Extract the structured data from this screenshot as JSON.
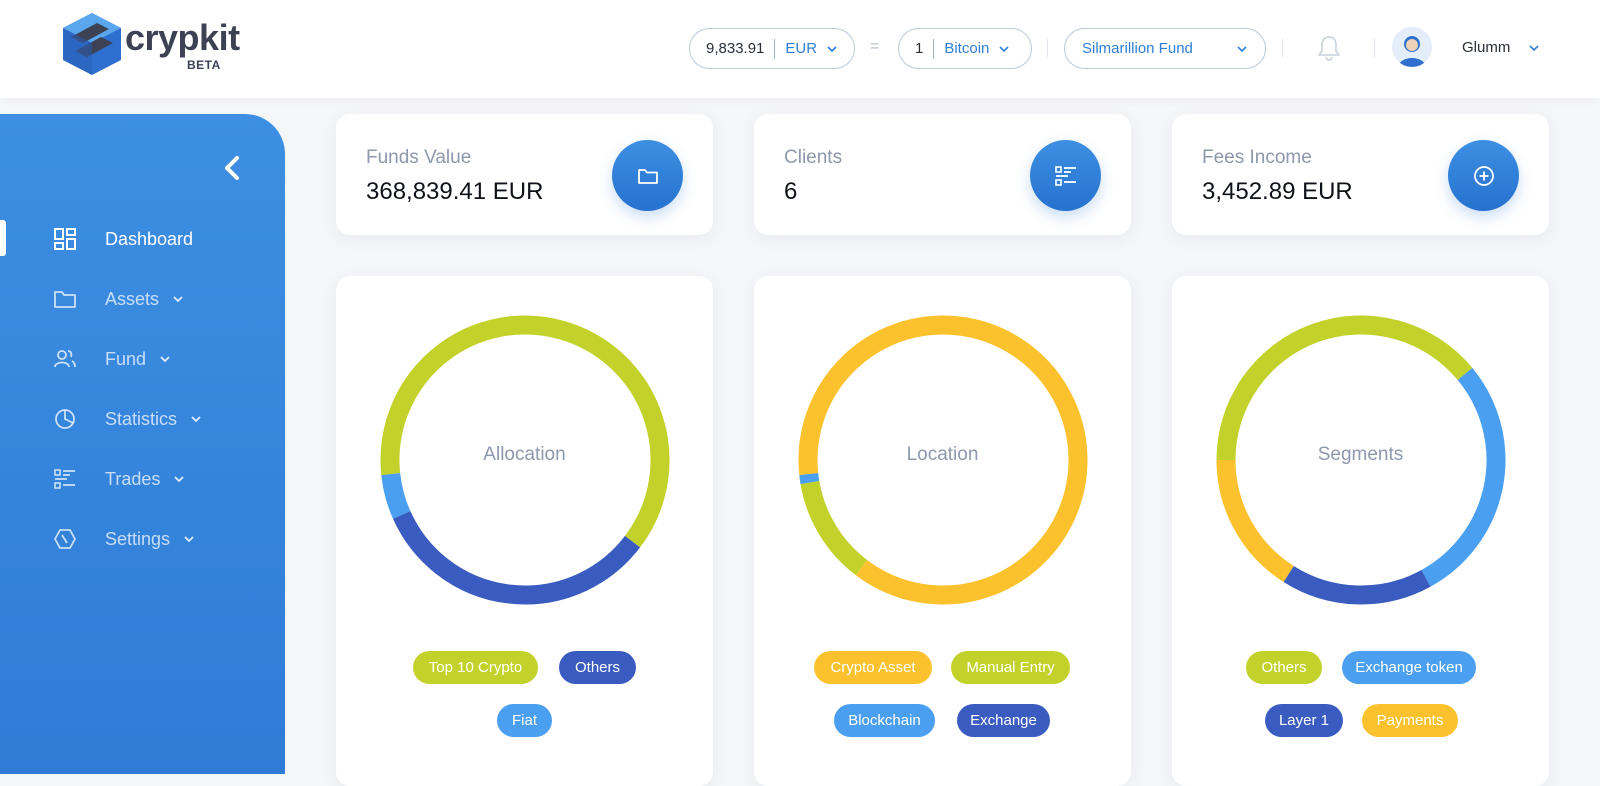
{
  "brand": {
    "name": "crypkit",
    "badge": "BETA"
  },
  "header": {
    "amount": {
      "value": "9,833.91",
      "currency": "EUR"
    },
    "equals": "=",
    "crypto": {
      "value": "1",
      "unit": "Bitcoin"
    },
    "fund": "Silmarillion Fund",
    "username": "Glumm"
  },
  "sidebar": {
    "items": [
      {
        "label": "Dashboard",
        "icon": "dashboard-icon"
      },
      {
        "label": "Assets",
        "icon": "folder-icon"
      },
      {
        "label": "Fund",
        "icon": "users-icon"
      },
      {
        "label": "Statistics",
        "icon": "pie-chart-icon"
      },
      {
        "label": "Trades",
        "icon": "list-icon"
      },
      {
        "label": "Settings",
        "icon": "hexagon-icon"
      }
    ]
  },
  "stats": [
    {
      "label": "Funds Value",
      "value": "368,839.41 EUR",
      "icon": "folder-icon"
    },
    {
      "label": "Clients",
      "value": "6",
      "icon": "list-icon"
    },
    {
      "label": "Fees Income",
      "value": "3,452.89 EUR",
      "icon": "plus-circle-icon"
    }
  ],
  "colors": {
    "lime": "#c3d12b",
    "darkblue": "#3a5bbf",
    "lightblue": "#4a9ff0",
    "yellow": "#fbc22d",
    "accent": "#2f7cd6"
  },
  "charts": [
    {
      "title": "Allocation",
      "legend": [
        {
          "label": "Top 10 Crypto",
          "color": "#c3d12b"
        },
        {
          "label": "Others",
          "color": "#3a5bbf"
        },
        {
          "label": "Fiat",
          "color": "#4a9ff0"
        }
      ]
    },
    {
      "title": "Location",
      "legend": [
        {
          "label": "Crypto Asset",
          "color": "#fbc22d"
        },
        {
          "label": "Manual Entry",
          "color": "#c3d12b"
        },
        {
          "label": "Blockchain",
          "color": "#4a9ff0"
        },
        {
          "label": "Exchange",
          "color": "#3a5bbf"
        }
      ]
    },
    {
      "title": "Segments",
      "legend": [
        {
          "label": "Others",
          "color": "#c3d12b"
        },
        {
          "label": "Exchange token",
          "color": "#4a9ff0"
        },
        {
          "label": "Layer 1",
          "color": "#3a5bbf"
        },
        {
          "label": "Payments",
          "color": "#fbc22d"
        }
      ]
    }
  ],
  "chart_data": [
    {
      "type": "pie",
      "title": "Allocation",
      "categories": [
        "Top 10 Crypto",
        "Others",
        "Fiat"
      ],
      "values": [
        0.62,
        0.33,
        0.05
      ]
    },
    {
      "type": "pie",
      "title": "Location",
      "categories": [
        "Crypto Asset",
        "Manual Entry",
        "Blockchain",
        "Exchange"
      ],
      "values": [
        0.87,
        0.12,
        0.01,
        0.0
      ]
    },
    {
      "type": "pie",
      "title": "Segments",
      "categories": [
        "Others",
        "Exchange token",
        "Layer 1",
        "Payments"
      ],
      "values": [
        0.39,
        0.28,
        0.17,
        0.16
      ]
    }
  ]
}
